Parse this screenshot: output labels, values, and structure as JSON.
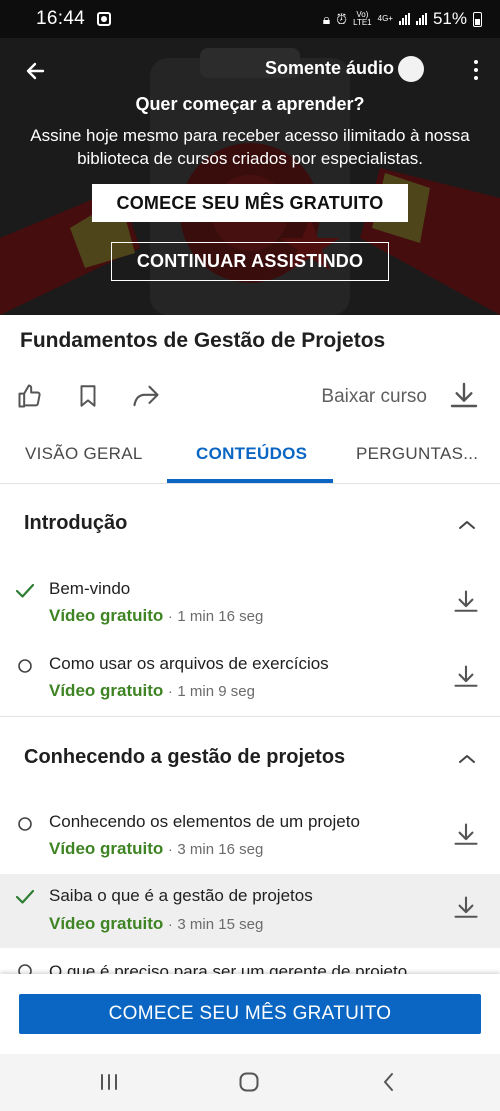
{
  "status_bar": {
    "time": "16:44",
    "network_top": "Vo)",
    "network_bottom": "LTE1",
    "network_type": "4G+",
    "battery_percent": "51%"
  },
  "hero": {
    "audio_only_label": "Somente áudio",
    "audio_only_enabled": false,
    "title": "Quer começar a aprender?",
    "description": "Assine hoje mesmo para receber acesso ilimitado à nossa biblioteca de cursos criados por especialistas.",
    "primary_button": "COMECE SEU MÊS GRATUITO",
    "secondary_button": "CONTINUAR ASSISTINDO"
  },
  "course": {
    "title": "Fundamentos de Gestão de Projetos",
    "download_label": "Baixar curso"
  },
  "icons": {
    "back": "arrow-left-icon",
    "more": "more-vertical-icon",
    "like": "thumbs-up-icon",
    "save": "bookmark-icon",
    "share": "share-icon",
    "download": "download-icon",
    "collapse": "chevron-up-icon",
    "completed": "check-icon",
    "not_started": "circle-icon"
  },
  "tabs": [
    {
      "label": "VISÃO GERAL",
      "active": false
    },
    {
      "label": "CONTEÚDOS",
      "active": true
    },
    {
      "label": "PERGUNTAS...",
      "active": false
    }
  ],
  "sections": [
    {
      "title": "Introdução",
      "lessons": [
        {
          "title": "Bem-vindo",
          "badge": "Vídeo gratuito",
          "separator": "·",
          "duration": "1 min 16 seg",
          "status": "completed"
        },
        {
          "title": "Como usar os arquivos de exercícios",
          "badge": "Vídeo gratuito",
          "separator": "·",
          "duration": "1 min 9 seg",
          "status": "not_started"
        }
      ]
    },
    {
      "title": "Conhecendo a gestão de projetos",
      "lessons": [
        {
          "title": "Conhecendo os elementos de um projeto",
          "badge": "Vídeo gratuito",
          "separator": "·",
          "duration": "3 min 16 seg",
          "status": "not_started"
        },
        {
          "title": "Saiba o que é a gestão de projetos",
          "badge": "Vídeo gratuito",
          "separator": "·",
          "duration": "3 min 15 seg",
          "status": "completed"
        },
        {
          "title": "O que é preciso para ser um gerente de projeto",
          "status": "not_started"
        }
      ]
    }
  ],
  "cta": {
    "label": "COMECE SEU MÊS GRATUITO"
  },
  "colors": {
    "brand_blue": "#0a66c2",
    "free_green": "#3f8424",
    "check_green": "#2e7d32",
    "hero_dark": "#2e2e2e",
    "hero_red": "#8b1a1a"
  }
}
